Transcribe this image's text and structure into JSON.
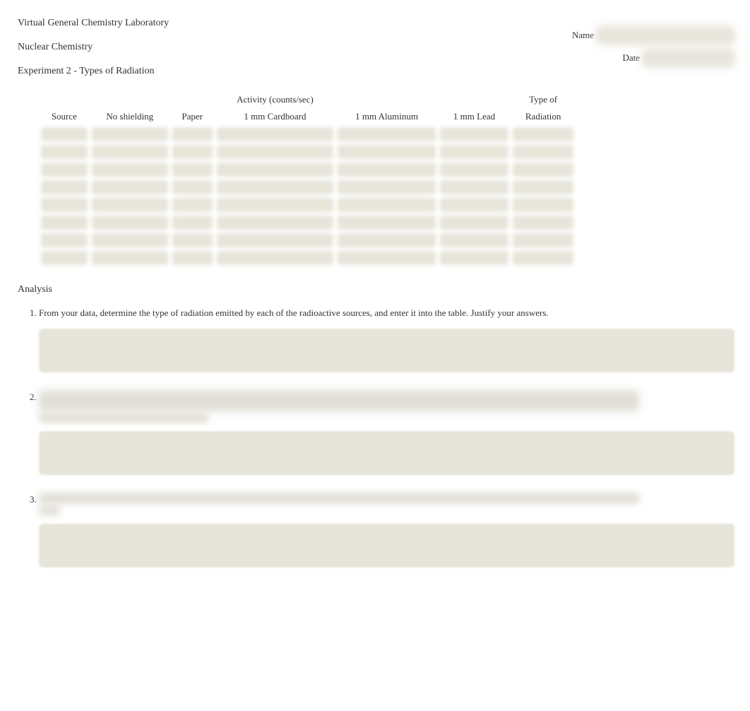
{
  "header": {
    "lab_title": "Virtual General Chemistry Laboratory",
    "topic": "Nuclear Chemistry",
    "experiment": "Experiment 2 - Types of Radiation",
    "name_label": "Name",
    "date_label": "Date"
  },
  "table": {
    "activity_header": "Activity (counts/sec)",
    "columns": {
      "source": "Source",
      "no_shielding": "No shielding",
      "paper": "Paper",
      "cardboard": "1 mm Cardboard",
      "aluminum": "1 mm Aluminum",
      "lead": "1 mm Lead",
      "type_line1": "Type of",
      "type_line2": "Radiation"
    },
    "row_count": 8
  },
  "analysis": {
    "title": "Analysis",
    "q1": "From your data, determine the type of radiation emitted by each of the radioactive sources, and enter it into the table. Justify your answers."
  }
}
